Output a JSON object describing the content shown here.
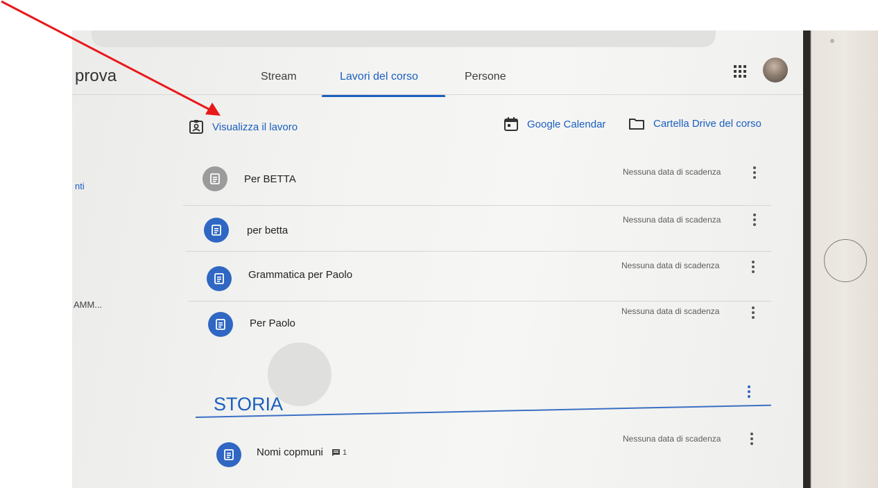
{
  "header": {
    "class_name": "prova",
    "tabs": [
      {
        "label": "Stream"
      },
      {
        "label": "Lavori del corso"
      },
      {
        "label": "Persone"
      }
    ]
  },
  "sidebar_fragments": [
    "nti",
    "AMM..."
  ],
  "toolbar": {
    "view_work": "Visualizza il lavoro",
    "calendar": "Google Calendar",
    "drive_folder": "Cartella Drive del corso"
  },
  "assignments": [
    {
      "title": "Per BETTA",
      "due": "Nessuna data di scadenza"
    },
    {
      "title": "per betta",
      "due": "Nessuna data di scadenza"
    },
    {
      "title": "Grammatica per Paolo",
      "due": "Nessuna data di scadenza"
    },
    {
      "title": "Per Paolo",
      "due": "Nessuna data di scadenza"
    }
  ],
  "topic": {
    "title": "STORIA",
    "items": [
      {
        "title": "Nomi copmuni",
        "comments": "1",
        "due": "Nessuna data di scadenza"
      }
    ]
  },
  "colors": {
    "accent": "#1a5fbf",
    "assignment_icon": "#2f67c3",
    "annotation_arrow": "#e8191b"
  }
}
